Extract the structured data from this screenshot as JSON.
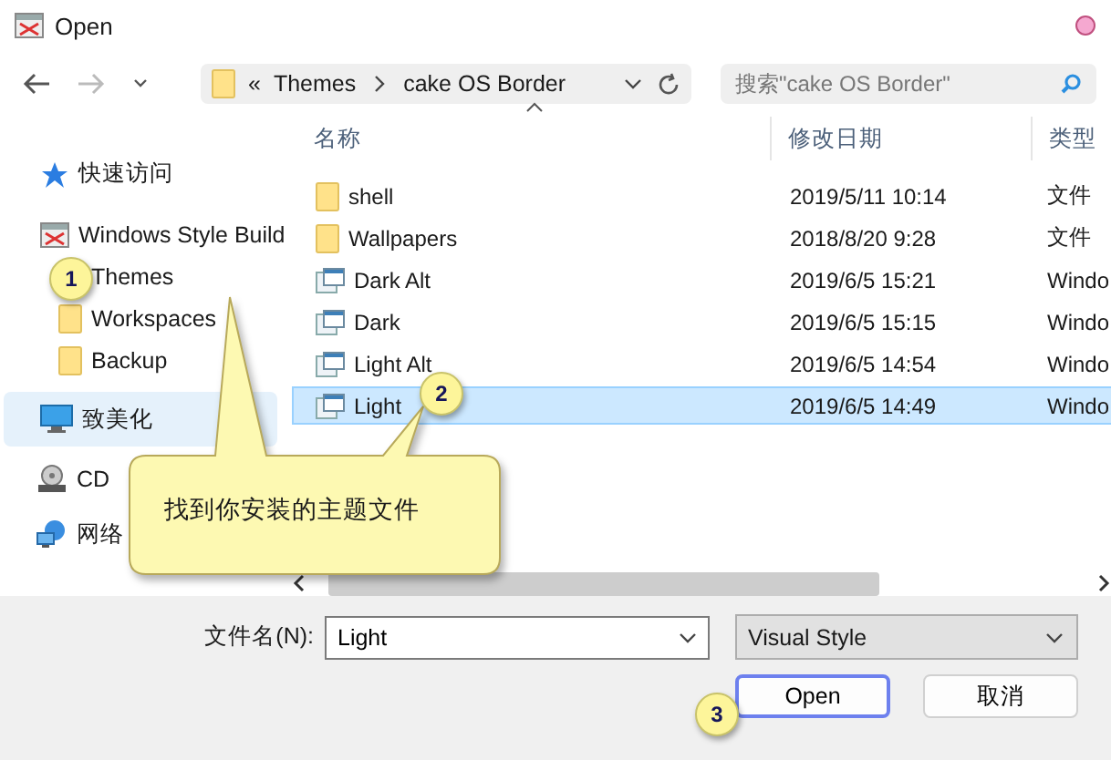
{
  "window": {
    "title": "Open"
  },
  "nav": {
    "back_enabled": true,
    "forward_enabled": false
  },
  "address": {
    "overflow": "«",
    "crumbs": [
      "Themes",
      "cake OS Border"
    ]
  },
  "search": {
    "placeholder": "搜索\"cake OS Border\""
  },
  "columns": [
    {
      "label": "名称",
      "sorted": true
    },
    {
      "label": "修改日期",
      "sorted": false
    },
    {
      "label": "类型",
      "sorted": false
    }
  ],
  "sidebar": [
    {
      "label": "快速访问",
      "kind": "star",
      "selected": false
    },
    {
      "label": "Windows Style Build",
      "kind": "app",
      "selected": false,
      "children": [
        {
          "label": "Themes",
          "kind": "folder",
          "selected": false
        },
        {
          "label": "Workspaces",
          "kind": "folder",
          "selected": false
        },
        {
          "label": "Backup",
          "kind": "folder",
          "selected": false
        }
      ]
    },
    {
      "label": "致美化",
      "kind": "pc",
      "selected": true
    },
    {
      "label": "CD",
      "kind": "disc",
      "selected": false
    },
    {
      "label": "网络",
      "kind": "network",
      "selected": false
    }
  ],
  "files": [
    {
      "name": "shell",
      "kind": "folder",
      "date": "2019/5/11 10:14",
      "type": "文件",
      "selected": false
    },
    {
      "name": "Wallpapers",
      "kind": "folder",
      "date": "2018/8/20 9:28",
      "type": "文件",
      "selected": false
    },
    {
      "name": "Dark Alt",
      "kind": "style",
      "date": "2019/6/5 15:21",
      "type": "Windo",
      "selected": false
    },
    {
      "name": "Dark",
      "kind": "style",
      "date": "2019/6/5 15:15",
      "type": "Windo",
      "selected": false
    },
    {
      "name": "Light Alt",
      "kind": "style",
      "date": "2019/6/5 14:54",
      "type": "Windo",
      "selected": false
    },
    {
      "name": "Light",
      "kind": "style",
      "date": "2019/6/5 14:49",
      "type": "Windo",
      "selected": true
    }
  ],
  "filename": {
    "label": "文件名(N):",
    "value": "Light"
  },
  "filetype": {
    "value": "Visual Style"
  },
  "buttons": [
    {
      "label": "Open",
      "default": true
    },
    {
      "label": "取消",
      "default": false
    }
  ],
  "callout": {
    "text": "找到你安装的主题文件"
  },
  "markers": [
    "1",
    "2",
    "3"
  ]
}
